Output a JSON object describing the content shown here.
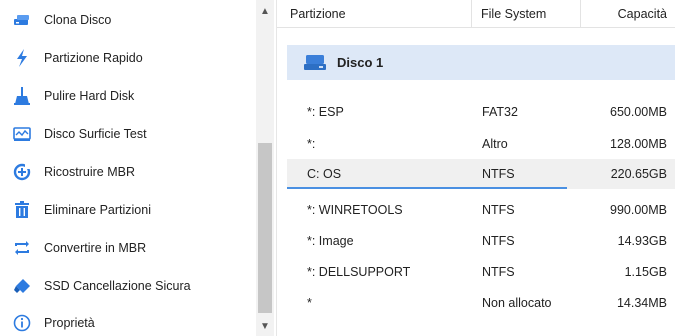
{
  "sidebar": {
    "items": [
      {
        "label": "Clona Disco",
        "icon": "clone-disk-icon"
      },
      {
        "label": "Partizione Rapido",
        "icon": "lightning-icon"
      },
      {
        "label": "Pulire Hard Disk",
        "icon": "wipe-disk-icon"
      },
      {
        "label": "Disco Surficie Test",
        "icon": "surface-test-icon"
      },
      {
        "label": "Ricostruire MBR",
        "icon": "rebuild-mbr-icon"
      },
      {
        "label": "Eliminare Partizioni",
        "icon": "trash-icon"
      },
      {
        "label": "Convertire in MBR",
        "icon": "convert-icon"
      },
      {
        "label": "SSD Cancellazione Sicura",
        "icon": "ssd-erase-icon"
      },
      {
        "label": "Proprietà",
        "icon": "info-icon"
      }
    ]
  },
  "table": {
    "headers": {
      "partition": "Partizione",
      "filesystem": "File System",
      "capacity": "Capacità"
    },
    "disk_label": "Disco 1",
    "rows": [
      {
        "partition": "*: ESP",
        "filesystem": "FAT32",
        "capacity": "650.00MB"
      },
      {
        "partition": "*:",
        "filesystem": "Altro",
        "capacity": "128.00MB"
      },
      {
        "partition": "C: OS",
        "filesystem": "NTFS",
        "capacity": "220.65GB"
      },
      {
        "partition": "*: WINRETOOLS",
        "filesystem": "NTFS",
        "capacity": "990.00MB"
      },
      {
        "partition": "*: Image",
        "filesystem": "NTFS",
        "capacity": "14.93GB"
      },
      {
        "partition": "*: DELLSUPPORT",
        "filesystem": "NTFS",
        "capacity": "1.15GB"
      },
      {
        "partition": "*",
        "filesystem": "Non allocato",
        "capacity": "14.34MB"
      }
    ],
    "selected_row": "C: OS"
  },
  "colors": {
    "accent": "#2d7be0",
    "disk_row_bg": "#dde8f7",
    "selection_line": "#4a90e2"
  }
}
